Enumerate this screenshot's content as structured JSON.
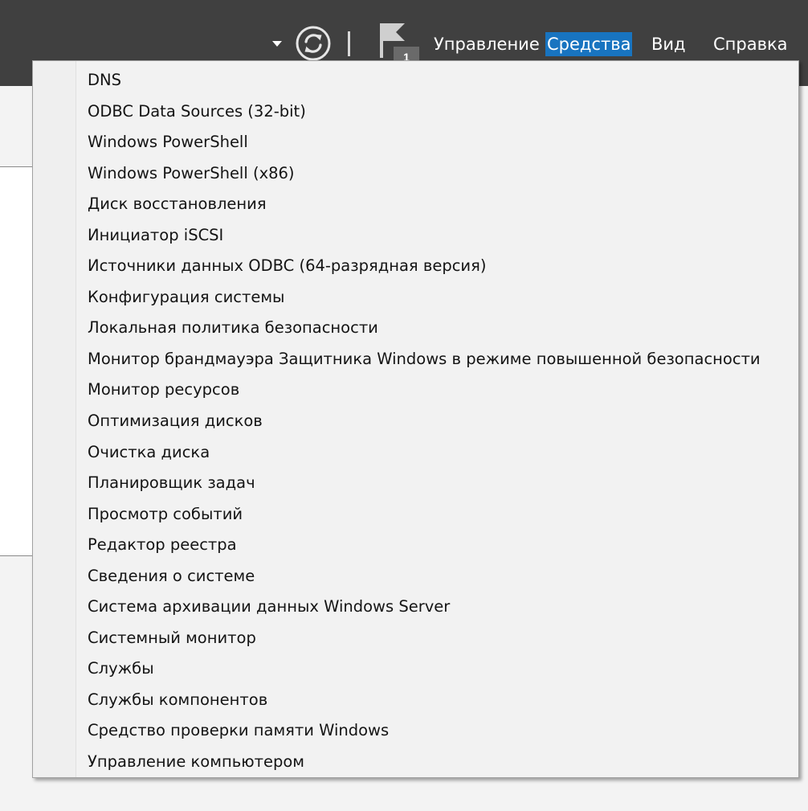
{
  "topbar": {
    "menus": {
      "manage": "Управление",
      "tools": "Средства",
      "view": "Вид",
      "help": "Справка"
    },
    "notification_count": "1",
    "colors": {
      "background": "#404040",
      "active_menu": "#1874c0"
    }
  },
  "tools_menu": {
    "items": [
      "DNS",
      "ODBC Data Sources (32-bit)",
      "Windows PowerShell",
      "Windows PowerShell (x86)",
      "Диск восстановления",
      "Инициатор iSCSI",
      "Источники данных ODBC (64-разрядная версия)",
      "Конфигурация системы",
      "Локальная политика безопасности",
      "Монитор брандмауэра Защитника Windows в режиме повышенной безопасности",
      "Монитор ресурсов",
      "Оптимизация дисков",
      "Очистка диска",
      "Планировщик задач",
      "Просмотр событий",
      "Редактор реестра",
      "Сведения о системе",
      "Система архивации данных Windows Server",
      "Системный монитор",
      "Службы",
      "Службы компонентов",
      "Средство проверки памяти Windows",
      "Управление компьютером"
    ]
  }
}
